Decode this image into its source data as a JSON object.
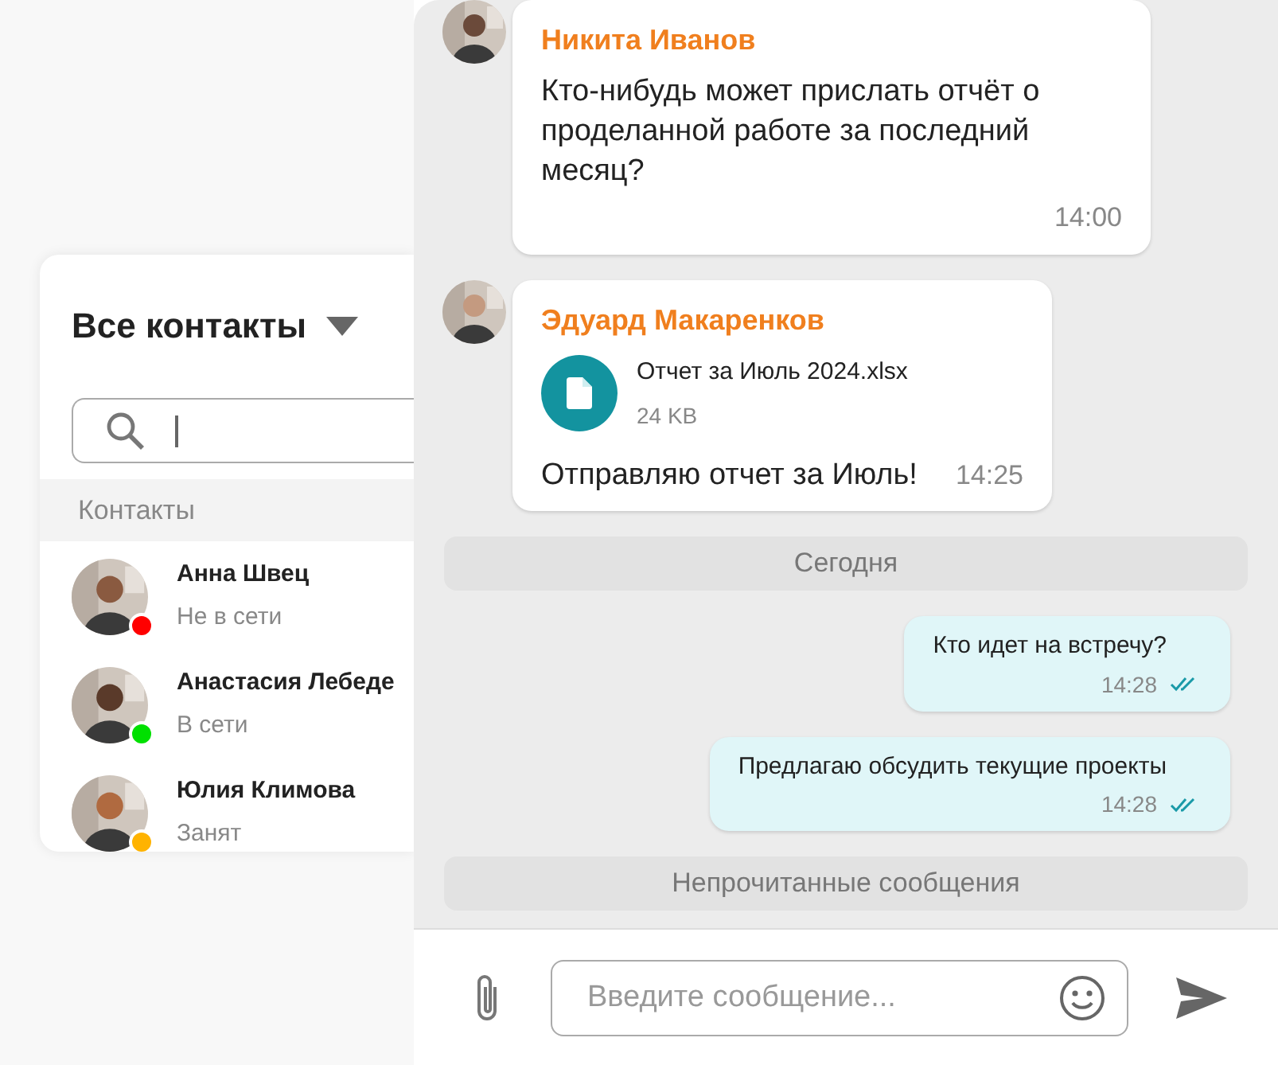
{
  "contacts_panel": {
    "title": "Все контакты",
    "section_label": "Контакты",
    "contacts": [
      {
        "name": "Анна Швец",
        "status": "Не в сети",
        "color": "#ff0000"
      },
      {
        "name": "Анастасия Лебеде",
        "status": "В сети",
        "color": "#00e000"
      },
      {
        "name": "Юлия Климова",
        "status": "Занят",
        "color": "#ffb300"
      }
    ]
  },
  "chat": {
    "messages": [
      {
        "kind": "incoming",
        "author": "Никита Иванов",
        "text": "Кто-нибудь может прислать отчёт о проделанной работе за последний месяц?",
        "time": "14:00"
      },
      {
        "kind": "incoming",
        "author": "Эдуард Макаренков",
        "attachment": {
          "name": "Отчет за Июль 2024.xlsx",
          "size": "24 KB"
        },
        "text": "Отправляю отчет за Июль!",
        "time": "14:25"
      },
      {
        "kind": "divider",
        "text": "Сегодня"
      },
      {
        "kind": "outgoing",
        "text": "Кто идет на встречу?",
        "time": "14:28",
        "read": true
      },
      {
        "kind": "outgoing",
        "text": "Предлагаю обсудить текущие проекты",
        "time": "14:28",
        "read": true
      },
      {
        "kind": "divider",
        "text": "Непрочитанные сообщения"
      }
    ],
    "composer": {
      "placeholder": "Введите сообщение..."
    }
  }
}
